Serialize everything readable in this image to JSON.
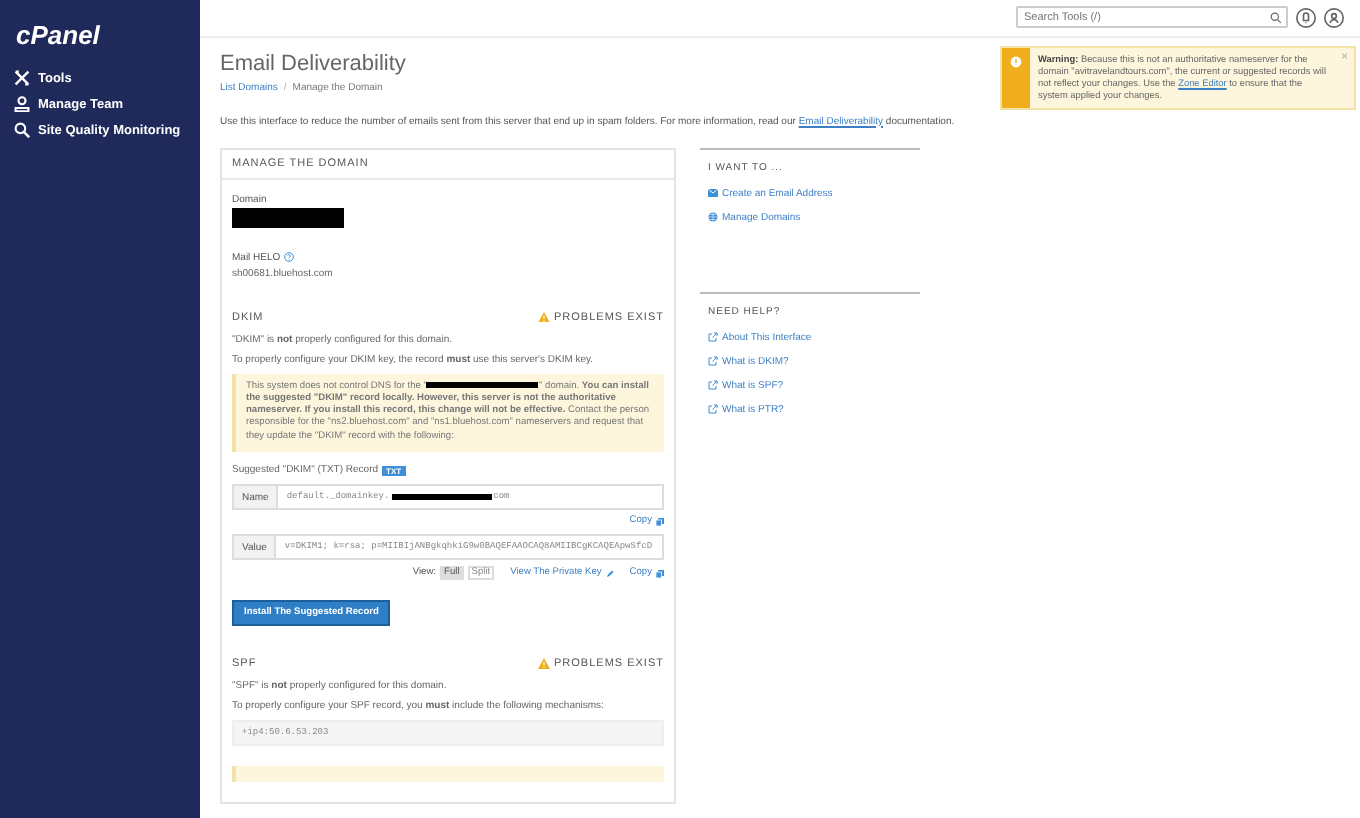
{
  "sidebar": {
    "logo": "cPanel",
    "items": [
      {
        "label": "Tools",
        "kind": "tools"
      },
      {
        "label": "Manage Team",
        "kind": "team"
      },
      {
        "label": "Site Quality Monitoring",
        "kind": "monitor"
      }
    ]
  },
  "header": {
    "search": {
      "placeholder": "Search Tools (/)"
    }
  },
  "warning": {
    "label": "Warning:",
    "before": "Because this is not an authoritative nameserver for the domain \"avitravelandtours.com\", the current or suggested records will not reflect your changes. Use the",
    "link": "Zone Editor",
    "after": "to ensure that the system applied your changes.",
    "close": "×"
  },
  "page": {
    "title": "Email Deliverability",
    "breadcrumb_separator": "/",
    "breadcrumbs": [
      {
        "label": "List Domains",
        "link": true
      },
      {
        "label": "Manage the Domain",
        "link": false
      }
    ],
    "intro": {
      "before": "Use this interface to reduce the number of emails sent from this server that end up in spam folders. For more information, read our",
      "link": "Email Deliverability",
      "after": "documentation."
    }
  },
  "manage": {
    "heading": "MANAGE THE DOMAIN",
    "domain_label": "Domain",
    "helo_label": "Mail HELO",
    "helo_value": "sh00681.bluehost.com"
  },
  "dkim": {
    "title": "DKIM",
    "status": "PROBLEMS EXIST",
    "lines": [
      "\"DKIM\" is **not** properly configured for this domain.",
      "To properly configure your DKIM key, the record **must** use this server's DKIM key."
    ],
    "notice_before": "This system does not control DNS for the \"",
    "notice_after": "\" domain. **You can install the suggested \"DKIM\" record locally. However, this server is not the authoritative nameserver. If you install this record, this change will not be effective.** Contact the person responsible for the \"ns2.bluehost.com\" and \"ns1.bluehost.com\" nameservers and request that they update the \"DKIM\" record with the following:",
    "suggested": "Suggested \"DKIM\" (TXT) Record",
    "badge": "TXT",
    "name_label": "Name",
    "name_before": "default._domainkey.",
    "name_after": "com",
    "copy": "Copy",
    "value_label": "Value",
    "value": "v=DKIM1; k=rsa; p=MIIBIjANBgkqhkiG9w0BAQEFAAOCAQ8AMIIBCgKCAQEApwSfcD",
    "view_label": "View:",
    "views": [
      {
        "label": "Full",
        "selected": true
      },
      {
        "label": "Split",
        "selected": false
      }
    ],
    "private_key": "View The Private Key",
    "copy2": "Copy",
    "install": "Install The Suggested Record"
  },
  "spf": {
    "title": "SPF",
    "status": "PROBLEMS EXIST",
    "lines": [
      "\"SPF\" is **not** properly configured for this domain.",
      "To properly configure your SPF record, you **must** include the following mechanisms:"
    ],
    "value": "+ip4:50.6.53.203"
  },
  "want": {
    "heading": "I WANT TO ...",
    "items": [
      {
        "label": "Create an Email Address",
        "kind": "email"
      },
      {
        "label": "Manage Domains",
        "kind": "globe"
      }
    ]
  },
  "help": {
    "heading": "NEED HELP?",
    "items": [
      {
        "label": "About This Interface",
        "kind": "external"
      },
      {
        "label": "What is DKIM?",
        "kind": "external"
      },
      {
        "label": "What is SPF?",
        "kind": "external"
      },
      {
        "label": "What is PTR?",
        "kind": "external"
      }
    ]
  }
}
